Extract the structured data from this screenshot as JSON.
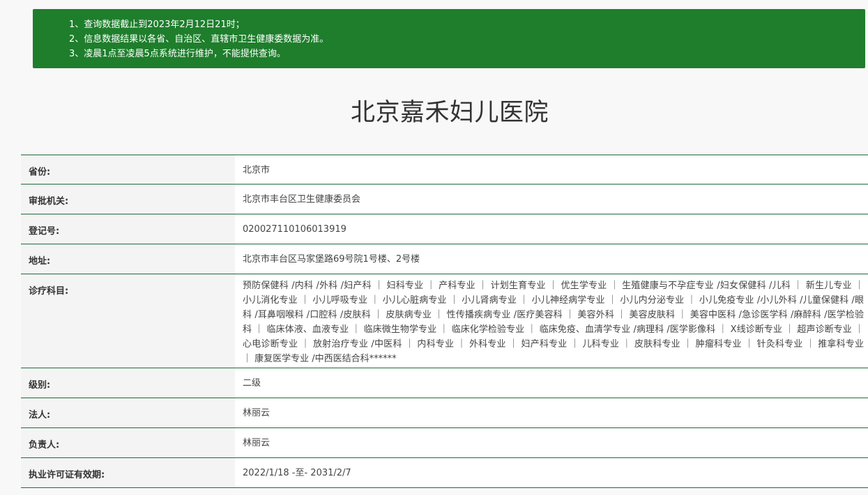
{
  "notice": {
    "lines": [
      "1、查询数据截止到2023年2月12日21时；",
      "2、信息数据结果以各省、自治区、直辖市卫生健康委数据为准。",
      "3、凌晨1点至凌晨5点系统进行维护，不能提供查询。"
    ]
  },
  "title": "北京嘉禾妇儿医院",
  "rows": [
    {
      "label": "省份:",
      "value": "北京市"
    },
    {
      "label": "审批机关:",
      "value": "北京市丰台区卫生健康委员会"
    },
    {
      "label": "登记号:",
      "value": "020027110106013919"
    },
    {
      "label": "地址:",
      "value": "北京市丰台区马家堡路69号院1号楼、2号楼"
    },
    {
      "label": "诊疗科目:",
      "value": "预防保健科 /内科 /外科 /妇产科 ｜ 妇科专业 ｜ 产科专业 ｜ 计划生育专业 ｜ 优生学专业 ｜ 生殖健康与不孕症专业 /妇女保健科 /儿科 ｜ 新生儿专业 ｜ 小儿消化专业 ｜ 小儿呼吸专业 ｜ 小儿心脏病专业 ｜ 小儿肾病专业 ｜ 小儿神经病学专业 ｜ 小儿内分泌专业 ｜ 小儿免疫专业 /小儿外科 /儿童保健科 /眼科 /耳鼻咽喉科 /口腔科 /皮肤科 ｜ 皮肤病专业 ｜ 性传播疾病专业 /医疗美容科 ｜ 美容外科 ｜ 美容皮肤科 ｜ 美容中医科 /急诊医学科 /麻醉科 /医学检验科 ｜ 临床体液、血液专业 ｜ 临床微生物学专业 ｜ 临床化学检验专业 ｜ 临床免疫、血清学专业 /病理科 /医学影像科 ｜ X线诊断专业 ｜ 超声诊断专业 ｜ 心电诊断专业 ｜ 放射治疗专业 /中医科 ｜ 内科专业 ｜ 外科专业 ｜ 妇产科专业 ｜ 儿科专业 ｜ 皮肤科专业 ｜ 肿瘤科专业 ｜ 针灸科专业 ｜ 推拿科专业 ｜ 康复医学专业 /中西医结合科******"
    },
    {
      "label": "级别:",
      "value": "二级"
    },
    {
      "label": "法人:",
      "value": "林丽云"
    },
    {
      "label": "负责人:",
      "value": "林丽云"
    },
    {
      "label": "执业许可证有效期:",
      "value": "2022/1/18 -至- 2031/2/7"
    }
  ],
  "colors": {
    "notice_bg": "#1e7e2c",
    "border": "#1f6b3a"
  }
}
